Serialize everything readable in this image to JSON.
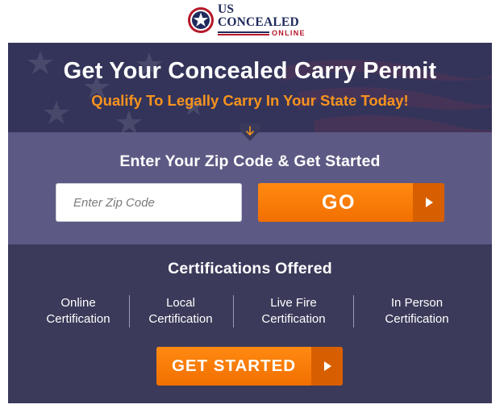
{
  "logo": {
    "main_text": "US CONCEALED",
    "sub_text": "ONLINE",
    "colors": {
      "navy": "#1f2a5c",
      "red": "#b5182b"
    }
  },
  "hero": {
    "title": "Get Your Concealed Carry Permit",
    "subtitle": "Qualify To Legally Carry In Your State Today!",
    "background_icon": "us-flag-stars-stripes"
  },
  "zip_form": {
    "heading": "Enter Your Zip Code & Get Started",
    "input_placeholder": "Enter Zip Code",
    "input_value": "",
    "go_label": "GO",
    "go_icon": "play-arrow-icon",
    "scroll_icon": "down-arrow-icon"
  },
  "certifications": {
    "heading": "Certifications Offered",
    "items": [
      {
        "line1": "Online",
        "line2": "Certification"
      },
      {
        "line1": "Local",
        "line2": "Certification"
      },
      {
        "line1": "Live Fire",
        "line2": "Certification"
      },
      {
        "line1": "In Person",
        "line2": "Certification"
      }
    ],
    "cta_label": "GET STARTED",
    "cta_icon": "play-arrow-icon"
  },
  "theme": {
    "accent": "#ff7a00",
    "accent_dark": "#d85f00",
    "hero_bg": "#363654",
    "band_bg": "#5c5a84",
    "certs_bg": "#3b3a5a",
    "subtitle_color": "#f7931e"
  }
}
